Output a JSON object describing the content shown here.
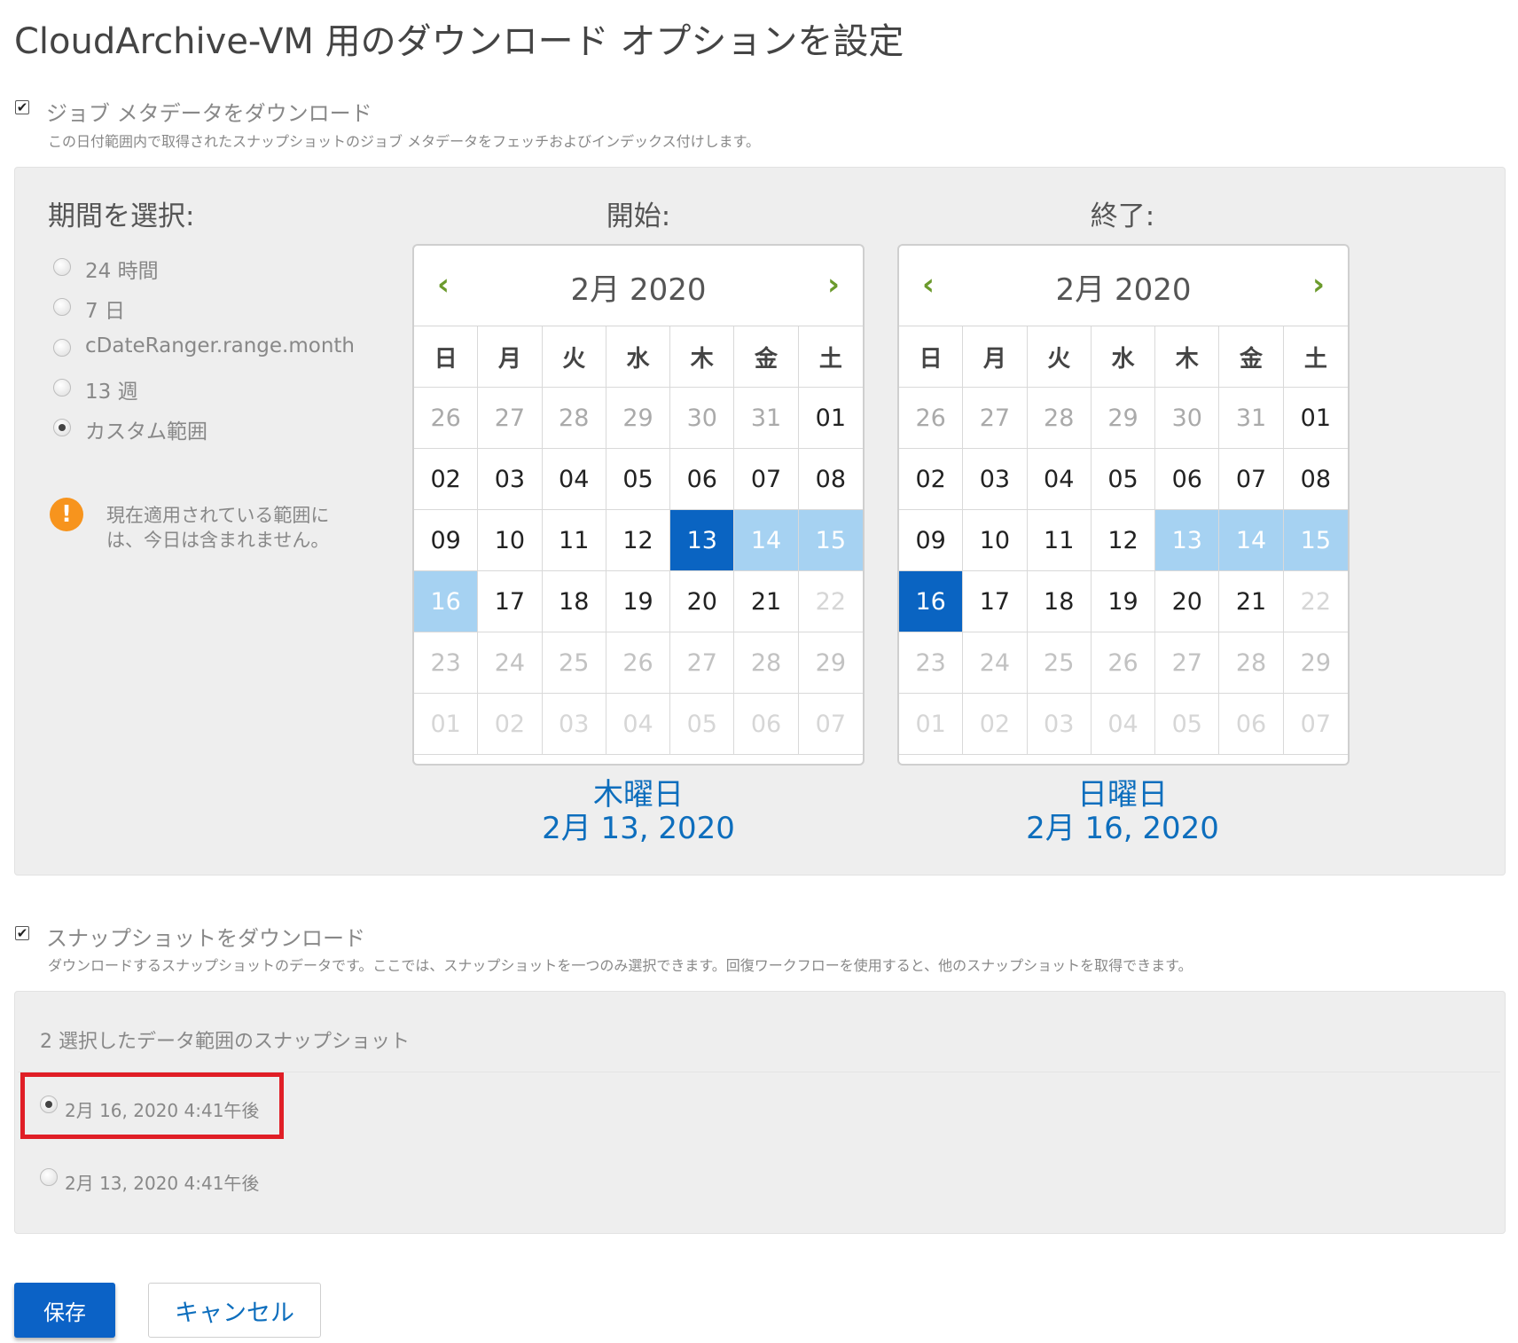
{
  "title": "CloudArchive-VM 用のダウンロード オプションを設定",
  "job_metadata": {
    "checked": true,
    "check_glyph": "✔",
    "label": "ジョブ メタデータをダウンロード",
    "description": "この日付範囲内で取得されたスナップショットのジョブ メタデータをフェッチおよびインデックス付けします。"
  },
  "period": {
    "heading": "期間を選択:",
    "options": [
      {
        "label": "24 時間",
        "selected": false
      },
      {
        "label": "7 日",
        "selected": false
      },
      {
        "label": "cDateRanger.range.month",
        "selected": false
      },
      {
        "label": "13 週",
        "selected": false
      },
      {
        "label": "カスタム範囲",
        "selected": true
      }
    ],
    "warning_icon": "!",
    "warning_line1": "現在適用されている範囲に",
    "warning_line2": "は、今日は含まれません。"
  },
  "calendars": {
    "weekdays": [
      "日",
      "月",
      "火",
      "水",
      "木",
      "金",
      "土"
    ],
    "prev_icon": "‹",
    "next_icon": "›",
    "start": {
      "heading": "開始:",
      "month_label": "2月 2020",
      "days": [
        [
          "26",
          "prev"
        ],
        [
          "27",
          "prev"
        ],
        [
          "28",
          "prev"
        ],
        [
          "29",
          "prev"
        ],
        [
          "30",
          "prev"
        ],
        [
          "31",
          "prev"
        ],
        [
          "01",
          ""
        ],
        [
          "02",
          ""
        ],
        [
          "03",
          ""
        ],
        [
          "04",
          ""
        ],
        [
          "05",
          ""
        ],
        [
          "06",
          ""
        ],
        [
          "07",
          ""
        ],
        [
          "08",
          ""
        ],
        [
          "09",
          ""
        ],
        [
          "10",
          ""
        ],
        [
          "11",
          ""
        ],
        [
          "12",
          ""
        ],
        [
          "13",
          "sel"
        ],
        [
          "14",
          "range"
        ],
        [
          "15",
          "range"
        ],
        [
          "16",
          "range"
        ],
        [
          "17",
          ""
        ],
        [
          "18",
          ""
        ],
        [
          "19",
          ""
        ],
        [
          "20",
          ""
        ],
        [
          "21",
          ""
        ],
        [
          "22",
          "next"
        ],
        [
          "23",
          "faded"
        ],
        [
          "24",
          "faded"
        ],
        [
          "25",
          "faded"
        ],
        [
          "26",
          "faded"
        ],
        [
          "27",
          "faded"
        ],
        [
          "28",
          "faded"
        ],
        [
          "29",
          "faded"
        ],
        [
          "01",
          "next"
        ],
        [
          "02",
          "next"
        ],
        [
          "03",
          "next"
        ],
        [
          "04",
          "next"
        ],
        [
          "05",
          "next"
        ],
        [
          "06",
          "next"
        ],
        [
          "07",
          "next"
        ]
      ],
      "selected_weekday": "木曜日",
      "selected_date": "2月 13, 2020"
    },
    "end": {
      "heading": "終了:",
      "month_label": "2月 2020",
      "days": [
        [
          "26",
          "prev"
        ],
        [
          "27",
          "prev"
        ],
        [
          "28",
          "prev"
        ],
        [
          "29",
          "prev"
        ],
        [
          "30",
          "prev"
        ],
        [
          "31",
          "prev"
        ],
        [
          "01",
          ""
        ],
        [
          "02",
          ""
        ],
        [
          "03",
          ""
        ],
        [
          "04",
          ""
        ],
        [
          "05",
          ""
        ],
        [
          "06",
          ""
        ],
        [
          "07",
          ""
        ],
        [
          "08",
          ""
        ],
        [
          "09",
          ""
        ],
        [
          "10",
          ""
        ],
        [
          "11",
          ""
        ],
        [
          "12",
          ""
        ],
        [
          "13",
          "range"
        ],
        [
          "14",
          "range"
        ],
        [
          "15",
          "range"
        ],
        [
          "16",
          "sel"
        ],
        [
          "17",
          ""
        ],
        [
          "18",
          ""
        ],
        [
          "19",
          ""
        ],
        [
          "20",
          ""
        ],
        [
          "21",
          ""
        ],
        [
          "22",
          "next"
        ],
        [
          "23",
          "faded"
        ],
        [
          "24",
          "faded"
        ],
        [
          "25",
          "faded"
        ],
        [
          "26",
          "faded"
        ],
        [
          "27",
          "faded"
        ],
        [
          "28",
          "faded"
        ],
        [
          "29",
          "faded"
        ],
        [
          "01",
          "next"
        ],
        [
          "02",
          "next"
        ],
        [
          "03",
          "next"
        ],
        [
          "04",
          "next"
        ],
        [
          "05",
          "next"
        ],
        [
          "06",
          "next"
        ],
        [
          "07",
          "next"
        ]
      ],
      "selected_weekday": "日曜日",
      "selected_date": "2月 16, 2020"
    }
  },
  "snapshots_option": {
    "checked": true,
    "check_glyph": "✔",
    "label": "スナップショットをダウンロード",
    "description": "ダウンロードするスナップショットのデータです。ここでは、スナップショットを一つのみ選択できます。回復ワークフローを使用すると、他のスナップショットを取得できます。"
  },
  "snapshot_list": {
    "count_label": "2 選択したデータ範囲のスナップショット",
    "items": [
      {
        "label": "2月 16, 2020 4:41午後",
        "selected": true
      },
      {
        "label": "2月 13, 2020 4:41午後",
        "selected": false
      }
    ]
  },
  "buttons": {
    "save": "保存",
    "cancel": "キャンセル"
  },
  "colors": {
    "accent": "#0b62c6",
    "range": "#a6d2f2",
    "warning": "#f7941d",
    "nav_arrow": "#6b9a2c",
    "highlight": "#e01e26"
  }
}
